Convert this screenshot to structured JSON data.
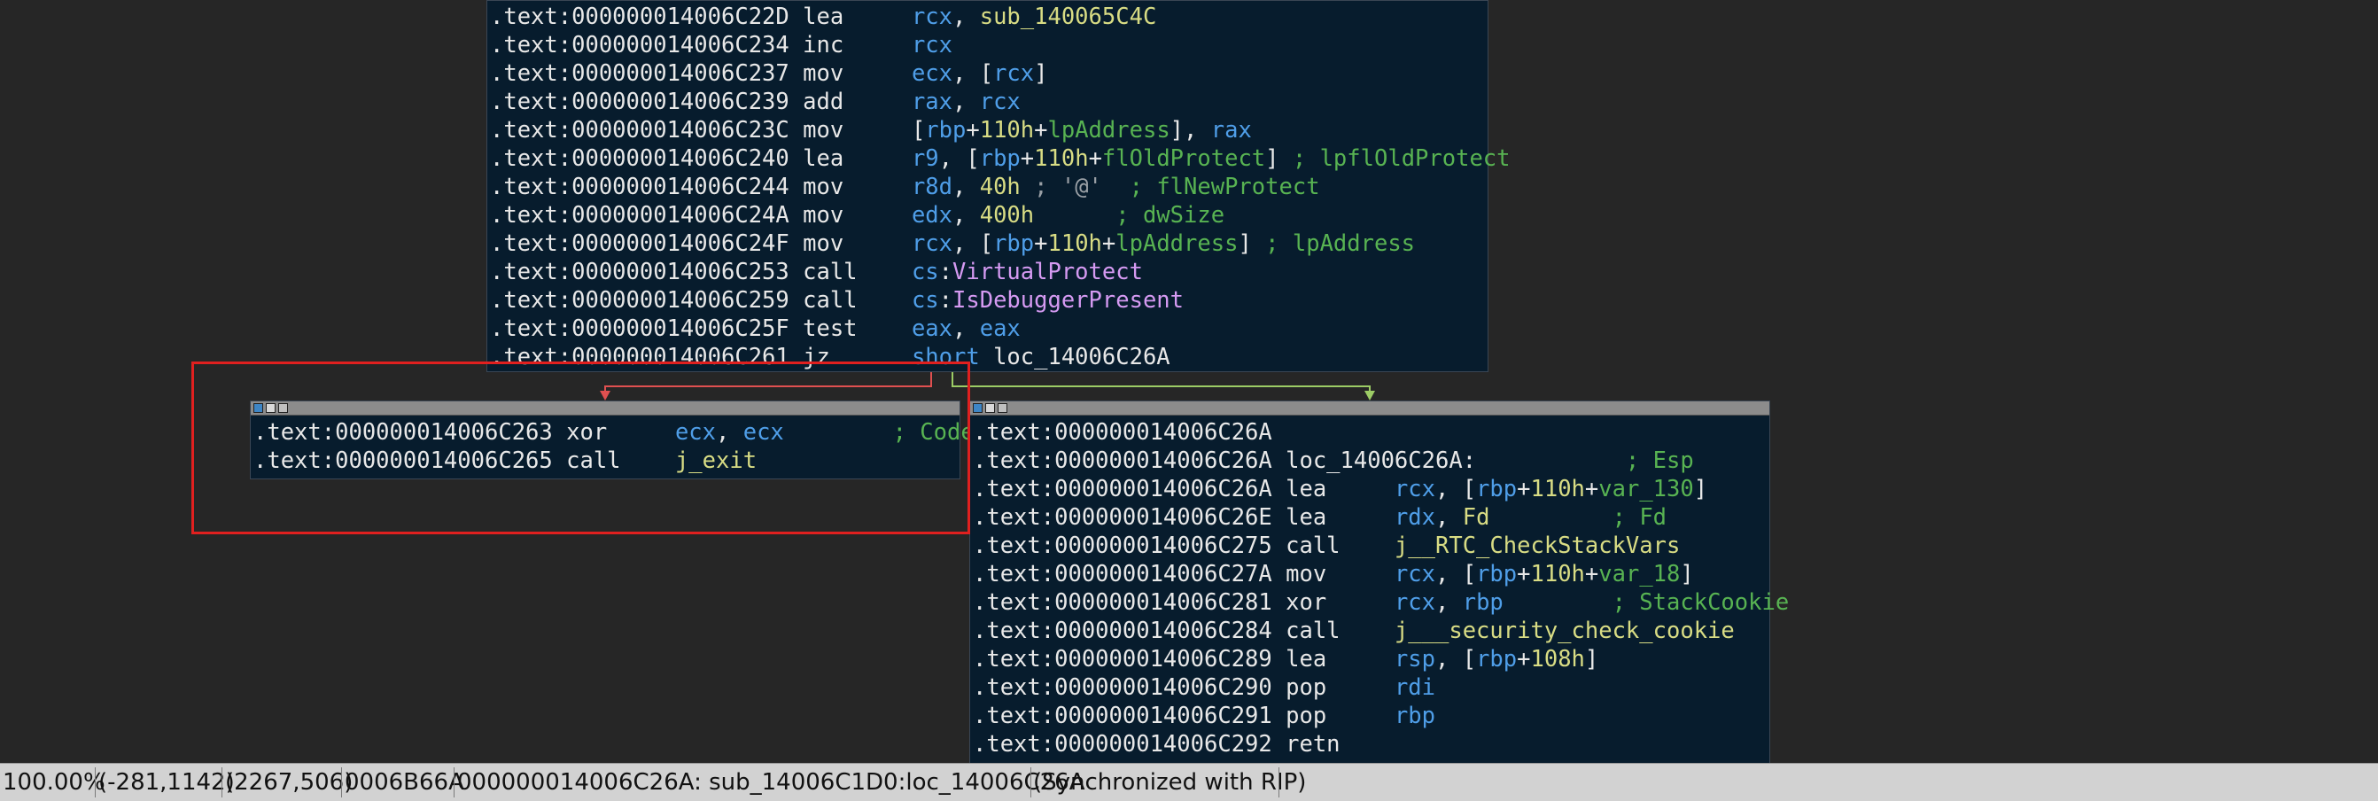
{
  "blocks": [
    {
      "id": "top",
      "lines": [
        [
          [
            "c-addr",
            ".text:000000014006C22D "
          ],
          [
            "c-mn",
            "lea     "
          ],
          [
            "c-reg",
            "rcx"
          ],
          [
            "c-plain",
            ", "
          ],
          [
            "c-sym",
            "sub_140065C4C"
          ]
        ],
        [
          [
            "c-addr",
            ".text:000000014006C234 "
          ],
          [
            "c-mn",
            "inc     "
          ],
          [
            "c-reg",
            "rcx"
          ]
        ],
        [
          [
            "c-addr",
            ".text:000000014006C237 "
          ],
          [
            "c-mn",
            "mov     "
          ],
          [
            "c-reg",
            "ecx"
          ],
          [
            "c-plain",
            ", ["
          ],
          [
            "c-reg",
            "rcx"
          ],
          [
            "c-plain",
            "]"
          ]
        ],
        [
          [
            "c-addr",
            ".text:000000014006C239 "
          ],
          [
            "c-mn",
            "add     "
          ],
          [
            "c-reg",
            "rax"
          ],
          [
            "c-plain",
            ", "
          ],
          [
            "c-reg",
            "rcx"
          ]
        ],
        [
          [
            "c-addr",
            ".text:000000014006C23C "
          ],
          [
            "c-mn",
            "mov     "
          ],
          [
            "c-plain",
            "["
          ],
          [
            "c-reg",
            "rbp"
          ],
          [
            "c-plain",
            "+"
          ],
          [
            "c-num",
            "110h"
          ],
          [
            "c-plain",
            "+"
          ],
          [
            "c-cmt",
            "lpAddress"
          ],
          [
            "c-plain",
            "], "
          ],
          [
            "c-reg",
            "rax"
          ]
        ],
        [
          [
            "c-addr",
            ".text:000000014006C240 "
          ],
          [
            "c-mn",
            "lea     "
          ],
          [
            "c-reg",
            "r9"
          ],
          [
            "c-plain",
            ", ["
          ],
          [
            "c-reg",
            "rbp"
          ],
          [
            "c-plain",
            "+"
          ],
          [
            "c-num",
            "110h"
          ],
          [
            "c-plain",
            "+"
          ],
          [
            "c-cmt",
            "flOldProtect"
          ],
          [
            "c-plain",
            "] "
          ],
          [
            "c-cmt",
            "; lpflOldProtect"
          ]
        ],
        [
          [
            "c-addr",
            ".text:000000014006C244 "
          ],
          [
            "c-mn",
            "mov     "
          ],
          [
            "c-reg",
            "r8d"
          ],
          [
            "c-plain",
            ", "
          ],
          [
            "c-num",
            "40h"
          ],
          [
            "c-str",
            " ; '@'"
          ],
          [
            "c-cmt",
            "  ; flNewProtect"
          ]
        ],
        [
          [
            "c-addr",
            ".text:000000014006C24A "
          ],
          [
            "c-mn",
            "mov     "
          ],
          [
            "c-reg",
            "edx"
          ],
          [
            "c-plain",
            ", "
          ],
          [
            "c-num",
            "400h"
          ],
          [
            "c-cmt",
            "      ; dwSize"
          ]
        ],
        [
          [
            "c-addr",
            ".text:000000014006C24F "
          ],
          [
            "c-mn",
            "mov     "
          ],
          [
            "c-reg",
            "rcx"
          ],
          [
            "c-plain",
            ", ["
          ],
          [
            "c-reg",
            "rbp"
          ],
          [
            "c-plain",
            "+"
          ],
          [
            "c-num",
            "110h"
          ],
          [
            "c-plain",
            "+"
          ],
          [
            "c-cmt",
            "lpAddress"
          ],
          [
            "c-plain",
            "] "
          ],
          [
            "c-cmt",
            "; lpAddress"
          ]
        ],
        [
          [
            "c-addr",
            ".text:000000014006C253 "
          ],
          [
            "c-mn",
            "call    "
          ],
          [
            "c-reg",
            "cs"
          ],
          [
            "c-plain",
            ":"
          ],
          [
            "c-api",
            "VirtualProtect"
          ]
        ],
        [
          [
            "c-addr",
            ".text:000000014006C259 "
          ],
          [
            "c-mn",
            "call    "
          ],
          [
            "c-reg",
            "cs"
          ],
          [
            "c-plain",
            ":"
          ],
          [
            "c-api",
            "IsDebuggerPresent"
          ]
        ],
        [
          [
            "c-addr",
            ".text:000000014006C25F "
          ],
          [
            "c-mn",
            "test    "
          ],
          [
            "c-reg",
            "eax"
          ],
          [
            "c-plain",
            ", "
          ],
          [
            "c-reg",
            "eax"
          ]
        ],
        [
          [
            "c-addr",
            ".text:000000014006C261 "
          ],
          [
            "c-mn",
            "jz      "
          ],
          [
            "c-reg",
            "short "
          ],
          [
            "c-plain",
            "loc_14006C26A"
          ]
        ]
      ]
    },
    {
      "id": "left",
      "lines": [
        [
          [
            "c-addr",
            ".text:000000014006C263 "
          ],
          [
            "c-mn",
            "xor     "
          ],
          [
            "c-reg",
            "ecx"
          ],
          [
            "c-plain",
            ", "
          ],
          [
            "c-reg",
            "ecx"
          ],
          [
            "c-cmt",
            "        ; Code"
          ]
        ],
        [
          [
            "c-addr",
            ".text:000000014006C265 "
          ],
          [
            "c-mn",
            "call    "
          ],
          [
            "c-sym",
            "j_exit"
          ]
        ]
      ]
    },
    {
      "id": "right",
      "lines": [
        [
          [
            "c-addr",
            ".text:000000014006C26A"
          ]
        ],
        [
          [
            "c-addr",
            ".text:000000014006C26A "
          ],
          [
            "c-plain",
            "loc_14006C26A:"
          ],
          [
            "c-cmt",
            "           ; Esp"
          ]
        ],
        [
          [
            "c-addr",
            ".text:000000014006C26A "
          ],
          [
            "c-mn",
            "lea     "
          ],
          [
            "c-reg",
            "rcx"
          ],
          [
            "c-plain",
            ", ["
          ],
          [
            "c-reg",
            "rbp"
          ],
          [
            "c-plain",
            "+"
          ],
          [
            "c-num",
            "110h"
          ],
          [
            "c-plain",
            "+"
          ],
          [
            "c-cmt",
            "var_130"
          ],
          [
            "c-plain",
            "]"
          ]
        ],
        [
          [
            "c-addr",
            ".text:000000014006C26E "
          ],
          [
            "c-mn",
            "lea     "
          ],
          [
            "c-reg",
            "rdx"
          ],
          [
            "c-plain",
            ", "
          ],
          [
            "c-sym",
            "Fd"
          ],
          [
            "c-cmt",
            "         ; Fd"
          ]
        ],
        [
          [
            "c-addr",
            ".text:000000014006C275 "
          ],
          [
            "c-mn",
            "call    "
          ],
          [
            "c-sym",
            "j__RTC_CheckStackVars"
          ]
        ],
        [
          [
            "c-addr",
            ".text:000000014006C27A "
          ],
          [
            "c-mn",
            "mov     "
          ],
          [
            "c-reg",
            "rcx"
          ],
          [
            "c-plain",
            ", ["
          ],
          [
            "c-reg",
            "rbp"
          ],
          [
            "c-plain",
            "+"
          ],
          [
            "c-num",
            "110h"
          ],
          [
            "c-plain",
            "+"
          ],
          [
            "c-cmt",
            "var_18"
          ],
          [
            "c-plain",
            "]"
          ]
        ],
        [
          [
            "c-addr",
            ".text:000000014006C281 "
          ],
          [
            "c-mn",
            "xor     "
          ],
          [
            "c-reg",
            "rcx"
          ],
          [
            "c-plain",
            ", "
          ],
          [
            "c-reg",
            "rbp"
          ],
          [
            "c-cmt",
            "        ; StackCookie"
          ]
        ],
        [
          [
            "c-addr",
            ".text:000000014006C284 "
          ],
          [
            "c-mn",
            "call    "
          ],
          [
            "c-sym",
            "j___security_check_cookie"
          ]
        ],
        [
          [
            "c-addr",
            ".text:000000014006C289 "
          ],
          [
            "c-mn",
            "lea     "
          ],
          [
            "c-reg",
            "rsp"
          ],
          [
            "c-plain",
            ", ["
          ],
          [
            "c-reg",
            "rbp"
          ],
          [
            "c-plain",
            "+"
          ],
          [
            "c-num",
            "108h"
          ],
          [
            "c-plain",
            "]"
          ]
        ],
        [
          [
            "c-addr",
            ".text:000000014006C290 "
          ],
          [
            "c-mn",
            "pop     "
          ],
          [
            "c-reg",
            "rdi"
          ]
        ],
        [
          [
            "c-addr",
            ".text:000000014006C291 "
          ],
          [
            "c-mn",
            "pop     "
          ],
          [
            "c-reg",
            "rbp"
          ]
        ],
        [
          [
            "c-addr",
            ".text:000000014006C292 "
          ],
          [
            "c-mn",
            "retn"
          ]
        ]
      ]
    }
  ],
  "statusbar": {
    "zoom": "100.00%",
    "mouse_coords": "(-281,1142)",
    "graph_coords": "(2267,506)",
    "file_offset": "0006B66A",
    "location": "000000014006C26A: sub_14006C1D0:loc_14006C26A",
    "sync": "(Synchronized with RIP)"
  },
  "colors": {
    "background": "#262626",
    "block_bg": "#071c2d",
    "register": "#4f9ee8",
    "number": "#d8dc84",
    "comment": "#58b352",
    "api": "#d59af2",
    "highlight_box": "#e0201f",
    "false_edge": "#e05050",
    "true_edge": "#9ccc65"
  }
}
